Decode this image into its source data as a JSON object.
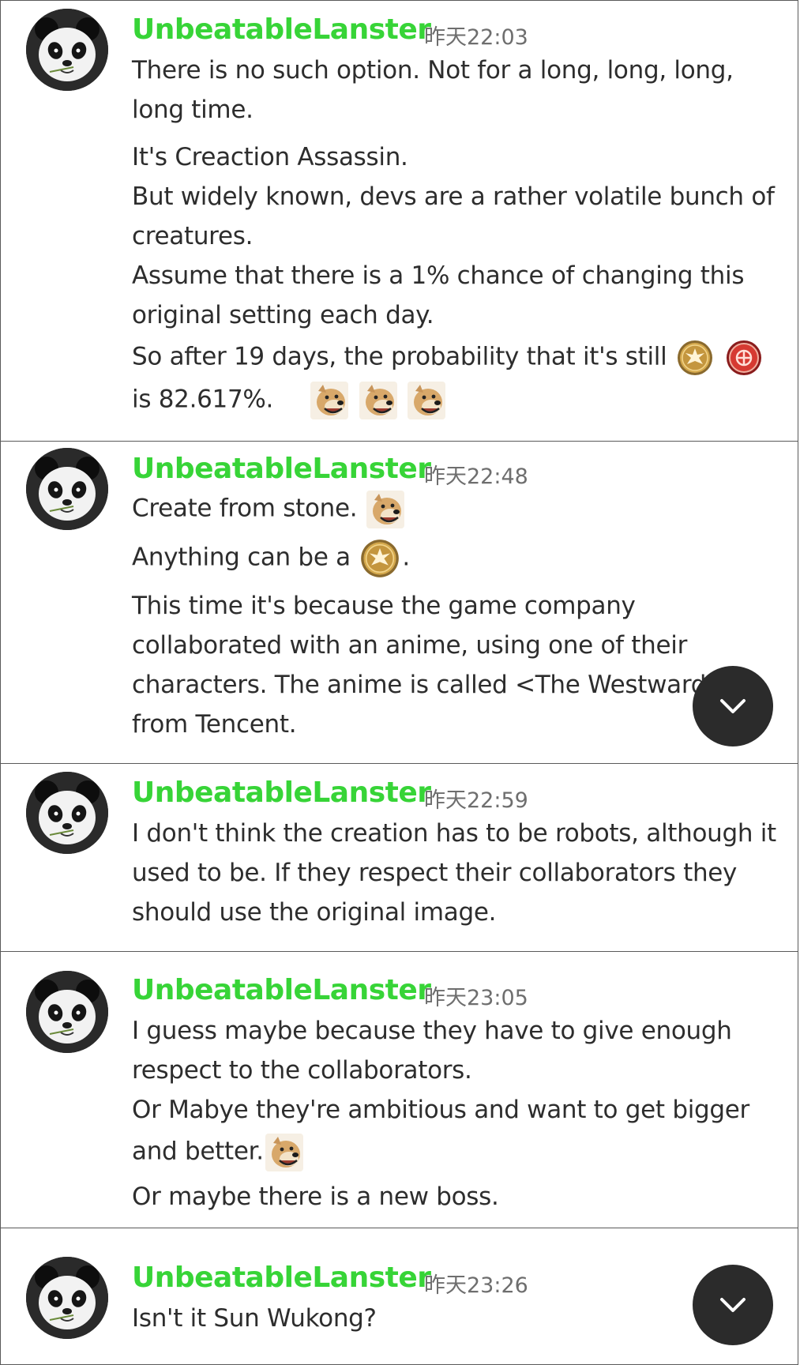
{
  "messages": [
    {
      "user": "UnbeatableLanster",
      "time": "昨天22:03",
      "lines": {
        "l1": "There is no such option.  Not for a long, long, long,",
        "l2": "long time.",
        "l3": "It's Creaction Assassin.",
        "l4": "But widely known, devs are a rather volatile bunch of",
        "l5": "creatures.",
        "l6": "Assume that there is a 1% chance of changing this",
        "l7": "original setting each day.",
        "l8": "So after 19 days, the probability that it's still",
        "l9": "is 82.617%."
      }
    },
    {
      "user": "UnbeatableLanster",
      "time": "昨天22:48",
      "lines": {
        "l1": "Create from stone.",
        "l2": "Anything can be a",
        "l2b": ".",
        "l3": "This time it's because the game company",
        "l4": "collaborated with an anime, using one of their",
        "l5": "characters. The anime is called <The Westward>",
        "l6": "from Tencent."
      }
    },
    {
      "user": "UnbeatableLanster",
      "time": "昨天22:59",
      "lines": {
        "l1": "I don't think the creation has to be robots, although it",
        "l2": "used to be.  If they respect their collaborators they",
        "l3": "should use the original image."
      }
    },
    {
      "user": "UnbeatableLanster",
      "time": "昨天23:05",
      "lines": {
        "l1": "I guess maybe because they have to give enough",
        "l2": "respect to the collaborators.",
        "l3": "Or Mabye they're ambitious and want to get bigger",
        "l4": "and better.",
        "l5": "Or maybe there is a new boss."
      }
    },
    {
      "user": "UnbeatableLanster",
      "time": "昨天23:26",
      "lines": {
        "l1": "Isn't it Sun Wukong?"
      }
    }
  ],
  "icons": {
    "avatar": "panda-avatar-icon",
    "emoji_dog": "doge-emoji-icon",
    "emoji_gold": "creation-class-gold-emblem-icon",
    "emoji_red": "assassin-red-emblem-icon",
    "scroll": "chevron-down-icon"
  },
  "colors": {
    "username": "#37d437",
    "timestamp": "#6e6e6e",
    "text": "#2d2d2d",
    "scroll_button": "#2b2b2b"
  }
}
